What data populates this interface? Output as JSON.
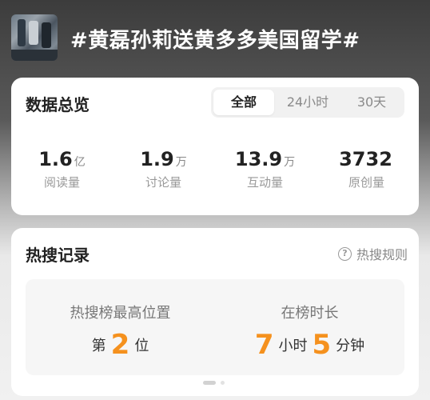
{
  "header": {
    "title": "#黄磊孙莉送黄多多美国留学#",
    "thumbnail_icon": "topic-thumbnail"
  },
  "overview": {
    "title": "数据总览",
    "tabs": [
      {
        "label": "全部",
        "active": true
      },
      {
        "label": "24小时",
        "active": false
      },
      {
        "label": "30天",
        "active": false
      }
    ],
    "stats": [
      {
        "value": "1.6",
        "unit": "亿",
        "label": "阅读量"
      },
      {
        "value": "1.9",
        "unit": "万",
        "label": "讨论量"
      },
      {
        "value": "13.9",
        "unit": "万",
        "label": "互动量"
      },
      {
        "value": "3732",
        "unit": "",
        "label": "原创量"
      }
    ]
  },
  "hot_search": {
    "title": "热搜记录",
    "rules_label": "热搜规则",
    "rules_icon": "question-circle-icon",
    "peak": {
      "title": "热搜榜最高位置",
      "prefix": "第",
      "value": "2",
      "suffix": "位"
    },
    "duration": {
      "title": "在榜时长",
      "hours": "7",
      "hours_unit": "小时",
      "minutes": "5",
      "minutes_unit": "分钟"
    }
  },
  "colors": {
    "accent": "#f5911e",
    "card": "#ffffff",
    "header_text": "#ffffff"
  }
}
